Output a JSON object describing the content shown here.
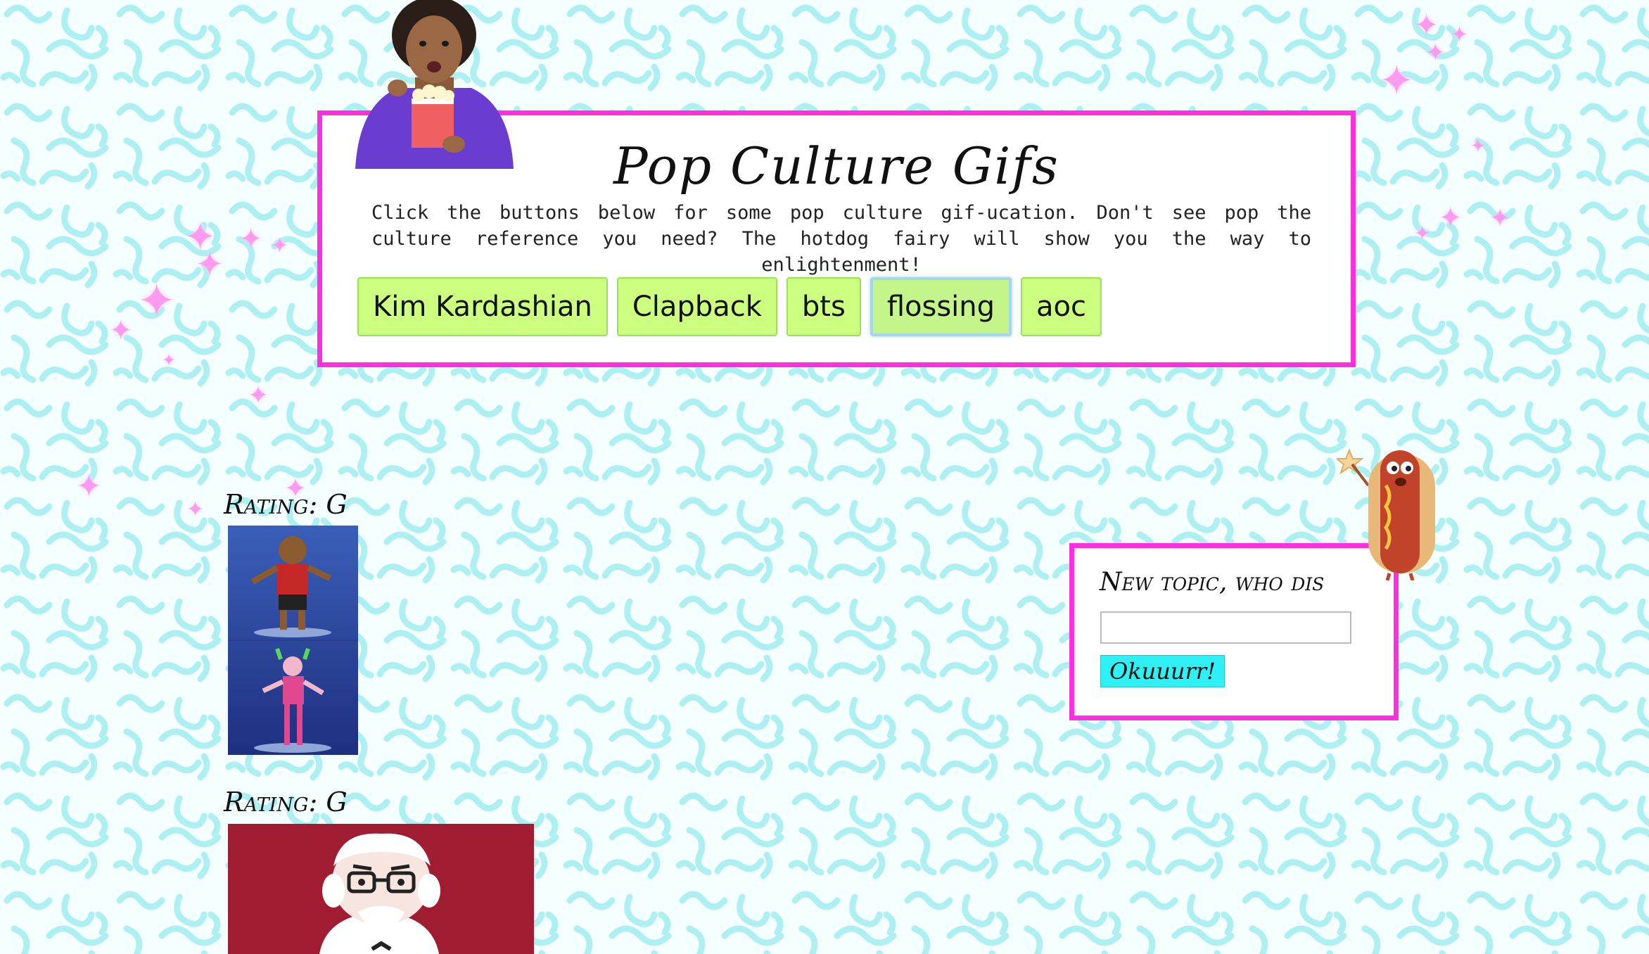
{
  "header": {
    "title": "Pop Culture Gifs",
    "intro": "Click the buttons below for some pop culture gif-ucation. Don't see pop the culture reference you need? The hotdog fairy will show you the way to enlightenment!",
    "buttons": [
      {
        "label": "Kim Kardashian"
      },
      {
        "label": "Clapback"
      },
      {
        "label": "bts"
      },
      {
        "label": "flossing"
      },
      {
        "label": "aoc"
      }
    ],
    "active_button": "flossing"
  },
  "results": [
    {
      "rating_label": "Rating: G"
    },
    {
      "rating_label": "Rating: G"
    }
  ],
  "new_topic": {
    "heading": "New topic, who dis",
    "input_value": "",
    "submit_label": "Okuuurr!"
  },
  "colors": {
    "card_border": "#ff2fe0",
    "topic_button": "#ccff7f",
    "submit_button": "#2ff0f4",
    "squiggle": "#aef0f2"
  },
  "icons": [
    "sparkle-icon",
    "popcorn-woman-illustration",
    "hotdog-fairy-illustration"
  ]
}
